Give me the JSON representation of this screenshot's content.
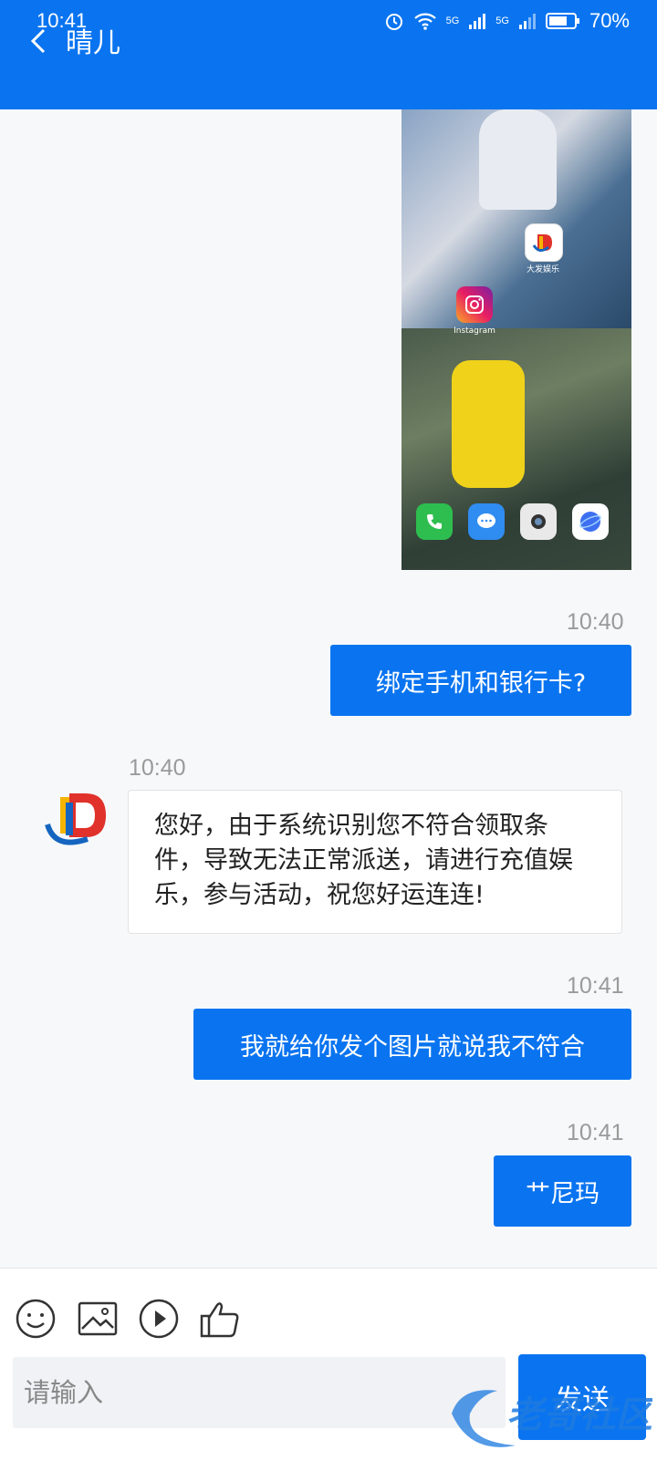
{
  "status": {
    "time": "10:41",
    "battery": "70%",
    "net1": "5G",
    "net2": "5G"
  },
  "header": {
    "title": "晴儿"
  },
  "screenshot": {
    "app1_label": "大发娱乐",
    "app2_label": "Instagram"
  },
  "messages": [
    {
      "side": "me",
      "time": "10:40",
      "text": "绑定手机和银行卡?"
    },
    {
      "side": "them",
      "time": "10:40",
      "text": "您好，由于系统识别您不符合领取条件，导致无法正常派送，请进行充值娱乐，参与活动，祝您好运连连!"
    },
    {
      "side": "me",
      "time": "10:41",
      "text": "我就给你发个图片就说我不符合"
    },
    {
      "side": "me",
      "time": "10:41",
      "text": "艹尼玛"
    }
  ],
  "composer": {
    "placeholder": "请输入",
    "send_label": "发送"
  },
  "watermark": {
    "text": "老哥社区"
  },
  "colors": {
    "accent": "#0a74f0"
  }
}
